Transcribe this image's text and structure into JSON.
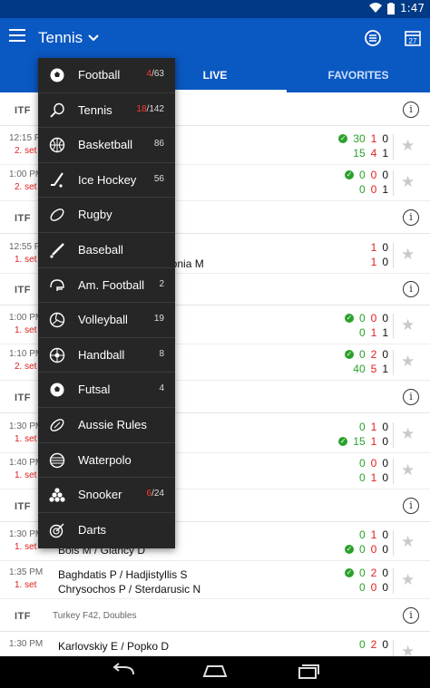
{
  "status": {
    "time": "1:47"
  },
  "appbar": {
    "title": "Tennis"
  },
  "tabs": [
    {
      "label": "LIVE"
    },
    {
      "label": "FAVORITES"
    }
  ],
  "leagues": [
    {
      "badge": "ITF",
      "name": ""
    },
    {
      "badge": "ITF",
      "name": ""
    },
    {
      "badge": "ITF",
      "name": ""
    },
    {
      "badge": "ITF",
      "name": ""
    },
    {
      "badge": "ITF",
      "name": ""
    },
    {
      "badge": "ITF",
      "name": "Turkey F42, Doubles"
    }
  ],
  "matches": [
    {
      "time": "12:15 PM",
      "status": "2. set",
      "p1": "",
      "p2": "",
      "s1": [
        "30",
        "1",
        "0"
      ],
      "s2": [
        "15",
        "4",
        "1"
      ]
    },
    {
      "time": "1:00 PM",
      "status": "2. set",
      "p1": "",
      "p2": "",
      "s1": [
        "0",
        "0",
        "0"
      ],
      "s2": [
        "0",
        "0",
        "1"
      ]
    },
    {
      "time": "12:55 PM",
      "status": "1. set",
      "p1": "",
      "p2": "kebnia M",
      "s1": [
        "1",
        "0"
      ],
      "s2": [
        "1",
        "0"
      ]
    },
    {
      "time": "1:00 PM",
      "status": "1. set",
      "p1": "",
      "p2": "",
      "s1": [
        "0",
        "0",
        "0"
      ],
      "s2": [
        "0",
        "1",
        "1"
      ]
    },
    {
      "time": "1:10 PM",
      "status": "2. set",
      "p1": "",
      "p2": "",
      "s1": [
        "0",
        "2",
        "0"
      ],
      "s2": [
        "40",
        "5",
        "1"
      ]
    },
    {
      "time": "1:30 PM",
      "status": "1. set",
      "p1": "",
      "p2": "",
      "s1": [
        "0",
        "1",
        "0"
      ],
      "s2": [
        "15",
        "1",
        "0"
      ]
    },
    {
      "time": "1:40 PM",
      "status": "1. set",
      "p1": "",
      "p2": "",
      "s1": [
        "0",
        "0",
        "0"
      ],
      "s2": [
        "0",
        "1",
        "0"
      ]
    },
    {
      "time": "1:30 PM",
      "status": "1. set",
      "p1": "",
      "p2": "Bois M / Glancy D",
      "s1": [
        "0",
        "1",
        "0"
      ],
      "s2": [
        "0",
        "0",
        "0"
      ]
    },
    {
      "time": "1:35 PM",
      "status": "1. set",
      "p1": "Baghdatis P / Hadjistyllis S",
      "p2": "Chrysochos P / Sterdarusic N",
      "s1": [
        "0",
        "2",
        "0"
      ],
      "s2": [
        "0",
        "0",
        "0"
      ]
    },
    {
      "time": "1:30 PM",
      "status": "",
      "p1": "Karlovskiy E / Popko D",
      "p2": "",
      "s1": [
        "0",
        "2",
        "0"
      ],
      "s2": []
    }
  ],
  "dropdown": [
    {
      "label": "Football",
      "live": "4",
      "total": "63",
      "icon": "soccer-ball-icon"
    },
    {
      "label": "Tennis",
      "live": "18",
      "total": "142",
      "icon": "tennis-racket-icon"
    },
    {
      "label": "Basketball",
      "live": "",
      "total": "86",
      "icon": "basketball-icon"
    },
    {
      "label": "Ice Hockey",
      "live": "",
      "total": "56",
      "icon": "hockey-stick-icon"
    },
    {
      "label": "Rugby",
      "live": "",
      "total": "",
      "icon": "rugby-ball-icon"
    },
    {
      "label": "Baseball",
      "live": "",
      "total": "",
      "icon": "baseball-bat-icon"
    },
    {
      "label": "Am. Football",
      "live": "",
      "total": "2",
      "icon": "football-helmet-icon"
    },
    {
      "label": "Volleyball",
      "live": "",
      "total": "19",
      "icon": "volleyball-icon"
    },
    {
      "label": "Handball",
      "live": "",
      "total": "8",
      "icon": "handball-icon"
    },
    {
      "label": "Futsal",
      "live": "",
      "total": "4",
      "icon": "futsal-ball-icon"
    },
    {
      "label": "Aussie Rules",
      "live": "",
      "total": "",
      "icon": "aussie-ball-icon"
    },
    {
      "label": "Waterpolo",
      "live": "",
      "total": "",
      "icon": "waterpolo-ball-icon"
    },
    {
      "label": "Snooker",
      "live": "6",
      "total": "24",
      "icon": "snooker-balls-icon"
    },
    {
      "label": "Darts",
      "live": "",
      "total": "",
      "icon": "dartboard-icon"
    }
  ],
  "colors": {
    "primary": "#0a58c2",
    "statusbar": "#003a86",
    "live_red": "#e0211e",
    "score_green": "#2aa12a"
  }
}
